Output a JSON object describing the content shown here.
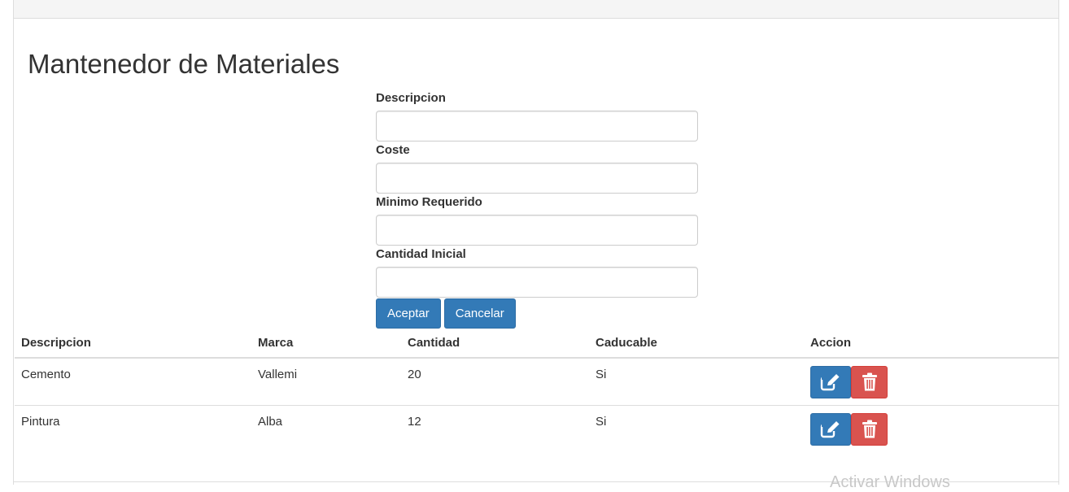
{
  "page": {
    "title": "Mantenedor de Materiales"
  },
  "form": {
    "fields": [
      {
        "label": "Descripcion",
        "value": "",
        "placeholder": ""
      },
      {
        "label": "Coste",
        "value": "",
        "placeholder": ""
      },
      {
        "label": "Minimo Requerido",
        "value": "",
        "placeholder": ""
      },
      {
        "label": "Cantidad Inicial",
        "value": "",
        "placeholder": ""
      }
    ],
    "accept_label": "Aceptar",
    "cancel_label": "Cancelar"
  },
  "table": {
    "headers": [
      "Descripcion",
      "Marca",
      "Cantidad",
      "Caducable",
      "Accion"
    ],
    "rows": [
      {
        "descripcion": "Cemento",
        "marca": "Vallemi",
        "cantidad": "20",
        "caducable": "Si"
      },
      {
        "descripcion": "Pintura",
        "marca": "Alba",
        "cantidad": "12",
        "caducable": "Si"
      }
    ]
  },
  "icons": {
    "edit": "edit-icon",
    "delete": "trash-icon"
  },
  "colors": {
    "primary": "#337ab7",
    "danger": "#d9534f"
  },
  "watermark": "Activar Windows"
}
